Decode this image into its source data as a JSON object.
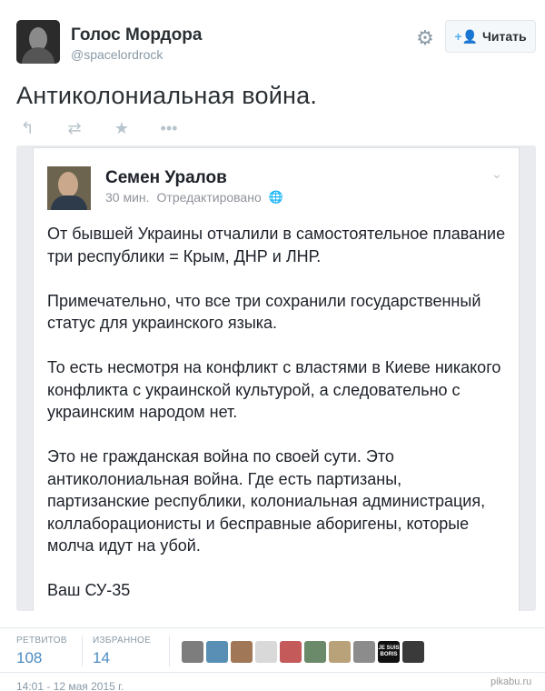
{
  "tweet": {
    "author_name": "Голос Мордора",
    "author_handle": "@spacelordrock",
    "follow_label": "Читать",
    "follow_icon": "add-user-icon",
    "text": "Антиколониальная война."
  },
  "actions": {
    "reply_icon": "reply-icon",
    "retweet_icon": "retweet-icon",
    "favorite_icon": "star-icon",
    "more_icon": "more-icon"
  },
  "embedded_post": {
    "author_name": "Семен Уралов",
    "time": "30 мин.",
    "edited": "Отредактировано",
    "paragraphs": [
      "От бывшей Украины отчалили в самостоятельное плавание три республики = Крым, ДНР и ЛНР.",
      "Примечательно, что все три сохранили государственный статус для украинского языка.",
      "То есть несмотря на конфликт с властями в Киеве никакого конфликта с украинской культурой, а следовательно с украинским народом нет.",
      "Это не гражданская война по своей сути. Это антиколониальная война. Где есть партизаны, партизанские республики, колониальная администрация, коллаборационисты и бесправные аборигены, которые молча идут на убой.",
      "Ваш СУ-35"
    ]
  },
  "stats": {
    "retweets_label": "РЕТВИТОВ",
    "retweets_count": "108",
    "favorites_label": "ИЗБРАННОЕ",
    "favorites_count": "14"
  },
  "favoriters": [
    {
      "color": "#7d7d7d",
      "label": ""
    },
    {
      "color": "#5a8fb5",
      "label": ""
    },
    {
      "color": "#a07858",
      "label": ""
    },
    {
      "color": "#d9d9d9",
      "label": ""
    },
    {
      "color": "#c45a5a",
      "label": ""
    },
    {
      "color": "#6a8a6a",
      "label": ""
    },
    {
      "color": "#b9a27a",
      "label": ""
    },
    {
      "color": "#8c8c8c",
      "label": ""
    },
    {
      "color": "#111111",
      "label": "JE SUIS BORIS"
    },
    {
      "color": "#3a3a3a",
      "label": ""
    }
  ],
  "footer": {
    "timestamp": "14:01 - 12 мая 2015 г.",
    "watermark": "pikabu.ru"
  }
}
